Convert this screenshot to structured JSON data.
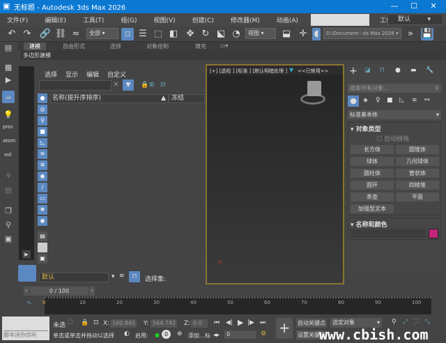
{
  "app": {
    "title": "无标题 - Autodesk 3ds Max 2026"
  },
  "menu": [
    "文件(F)",
    "编辑(E)",
    "工具(T)",
    "组(G)",
    "视图(V)",
    "创建(C)",
    "修改器(M)",
    "动画(A)",
    "»"
  ],
  "account": {
    "login": "登录",
    "workspace_label": "工作区:",
    "workspace_value": "默认"
  },
  "toolbar": {
    "selection_filter": "全部",
    "ref_coord": "视图",
    "project_path": "D:\\Document···ds Max 2026",
    "more": "»"
  },
  "ribbon": {
    "tabs": [
      "建模",
      "自由形式",
      "选择",
      "对象绘制",
      "填充"
    ],
    "subtab": "多边形建模"
  },
  "left_labels": [
    "proc",
    "atom",
    "vol"
  ],
  "scene_explorer": {
    "menu": [
      "选择",
      "显示",
      "编辑",
      "自定义"
    ],
    "search_value": "",
    "col_name": "名称(按升序排序)",
    "col_freeze": "冻结"
  },
  "viewport": {
    "label": "[+] [透视 ] [标准 ] [默认明暗处理 ]",
    "disabled": "<<已禁用>>"
  },
  "command_panel": {
    "search_placeholder": "搜索所有对象...",
    "category": "标准基本体",
    "rollout_object_type": "对象类型",
    "autogrid": "自动栅格",
    "buttons": [
      "长方体",
      "圆锥体",
      "球体",
      "几何球体",
      "圆柱体",
      "管状体",
      "圆环",
      "四棱锥",
      "茶壶",
      "平面",
      "加强型文本"
    ],
    "rollout_name_color": "名称和颜色",
    "object_color": "#c2257a"
  },
  "layer": {
    "name": "默认",
    "selection_set": "选择集:"
  },
  "time": {
    "slider": "0 / 100",
    "ticks": [
      "0",
      "10",
      "20",
      "30",
      "40",
      "50",
      "60",
      "70",
      "80",
      "90",
      "100"
    ]
  },
  "status": {
    "script_listener": "脚本迷你侦听",
    "selected": "未选",
    "x_label": "X:",
    "x": "160.845",
    "y_label": "Y:",
    "y": "564.742",
    "z_label": "Z:",
    "z": "0.0",
    "prompt": "单击或单击并拖动以选择",
    "enable": "启用:",
    "add_time_tag": "添加…标",
    "frame": "0",
    "autokey": "自动关键点",
    "setkey": "设置关键点",
    "key_filter": "选定对象"
  },
  "watermark": "www.cbish.com"
}
